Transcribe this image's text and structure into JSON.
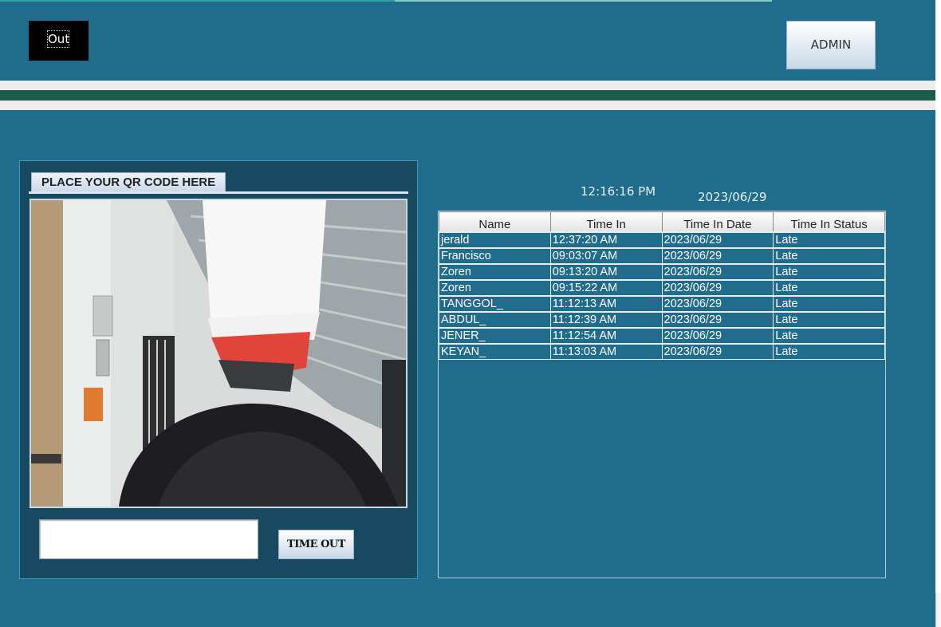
{
  "header": {
    "out_button_label": "Out",
    "admin_button_label": "ADMIN"
  },
  "scanner": {
    "tab_label": "PLACE YOUR QR CODE HERE",
    "input_value": "",
    "input_placeholder": "",
    "timeout_button_label": "TIME OUT"
  },
  "clock": {
    "time": "12:16:16 PM",
    "date": "2023/06/29"
  },
  "attendance_table": {
    "columns": [
      "Name",
      "Time In",
      "Time In Date",
      "Time In Status"
    ],
    "rows": [
      [
        "jerald",
        "12:37:20 AM",
        "2023/06/29",
        "Late"
      ],
      [
        "Francisco",
        "09:03:07 AM",
        "2023/06/29",
        "Late"
      ],
      [
        "Zoren",
        "09:13:20 AM",
        "2023/06/29",
        "Late"
      ],
      [
        "Zoren",
        "09:15:22 AM",
        "2023/06/29",
        "Late"
      ],
      [
        "TANGGOL_",
        "11:12:13 AM",
        "2023/06/29",
        "Late"
      ],
      [
        "ABDUL_",
        "11:12:39 AM",
        "2023/06/29",
        "Late"
      ],
      [
        "JENER_",
        "11:12:54 AM",
        "2023/06/29",
        "Late"
      ],
      [
        "KEYAN_",
        "11:13:03 AM",
        "2023/06/29",
        "Late"
      ]
    ]
  },
  "colors": {
    "background": "#206c8c",
    "scan_panel": "#174a60",
    "header_band": "#1b5c4c"
  }
}
